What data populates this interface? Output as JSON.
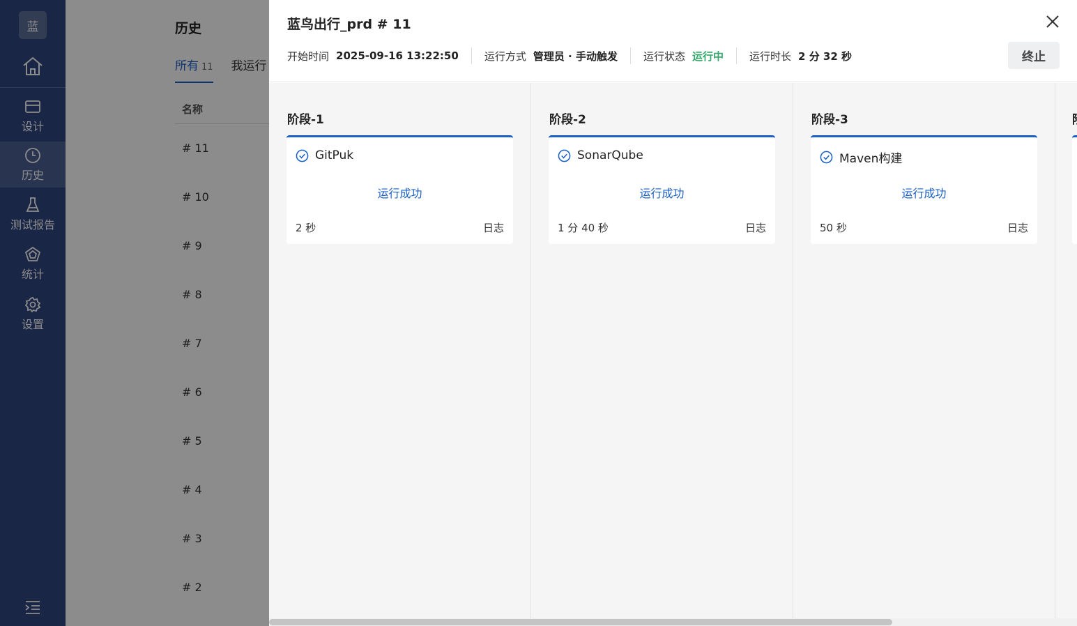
{
  "sidebar": {
    "logo_text": "蓝",
    "items": [
      {
        "label": "设计",
        "icon": "card-icon"
      },
      {
        "label": "历史",
        "icon": "clock-icon"
      },
      {
        "label": "测试报告",
        "icon": "flask-icon"
      },
      {
        "label": "统计",
        "icon": "pentagon-icon"
      },
      {
        "label": "设置",
        "icon": "gear-icon"
      }
    ]
  },
  "page": {
    "title": "历史",
    "tabs": [
      {
        "label": "所有",
        "count": "11"
      },
      {
        "label": "我运行",
        "count": ""
      }
    ],
    "column_name": "名称",
    "runs": [
      "# 11",
      "# 10",
      "# 9",
      "# 8",
      "# 7",
      "# 6",
      "# 5",
      "# 4",
      "# 3",
      "# 2"
    ]
  },
  "drawer": {
    "title": "蓝鸟出行_prd # 11",
    "meta": {
      "start_label": "开始时间",
      "start_value": "2025-09-16 13:22:50",
      "mode_label": "运行方式",
      "mode_value": "管理员 · 手动触发",
      "status_label": "运行状态",
      "status_value": "运行中",
      "duration_label": "运行时长",
      "duration_value": "2 分 32 秒"
    },
    "stop_button": "终止",
    "stages": [
      {
        "title": "阶段-1",
        "task": "GitPuk",
        "status": "运行成功",
        "time": "2 秒",
        "log": "日志"
      },
      {
        "title": "阶段-2",
        "task": "SonarQube",
        "status": "运行成功",
        "time": "1 分 40 秒",
        "log": "日志"
      },
      {
        "title": "阶段-3",
        "task": "Maven构建",
        "status": "运行成功",
        "time": "50 秒",
        "log": "日志"
      },
      {
        "title": "阶",
        "task": "",
        "status": "",
        "time": "",
        "log": ""
      }
    ]
  },
  "colors": {
    "sidebar_bg": "#2e4580",
    "accent_blue": "#1a5fc7",
    "status_green": "#35a86b"
  }
}
